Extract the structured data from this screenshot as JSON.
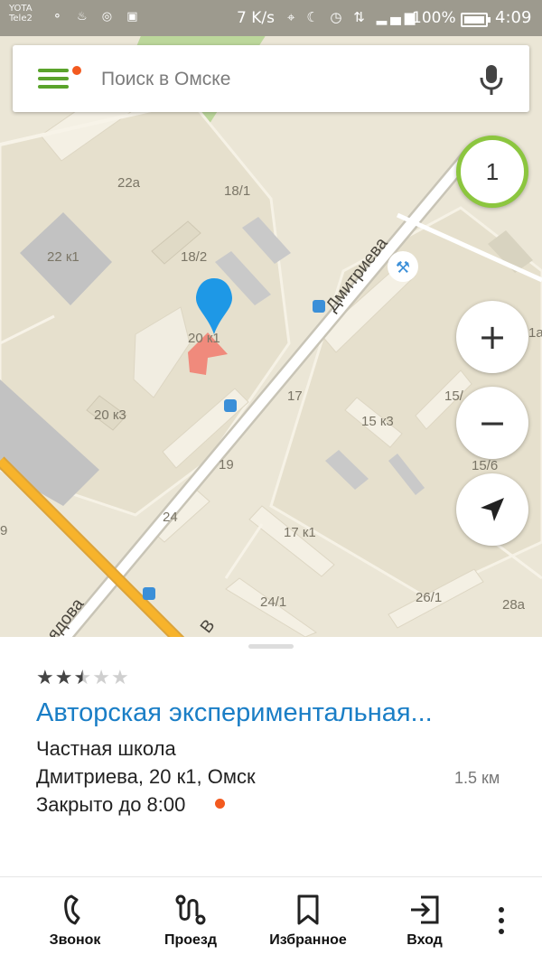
{
  "status_bar": {
    "carrier_line1": "YOTA",
    "carrier_line2": "Tele2",
    "net_speed": "7 K/s",
    "battery": "100%",
    "time": "4:09"
  },
  "search": {
    "placeholder": "Поиск в Омске"
  },
  "map": {
    "counter": "1",
    "streets": {
      "dmitrieva": "Дмитриева",
      "bottom_street": "рядова",
      "corner_letter": "В"
    },
    "labels": {
      "b22a": "22а",
      "b18_1": "18/1",
      "b22k1": "22 к1",
      "b18_2": "18/2",
      "b20k1": "20 к1",
      "b20k3": "20 к3",
      "b17": "17",
      "b15k3": "15 к3",
      "b15_partial": "15/",
      "b15_6": "15/6",
      "b19": "19",
      "b24": "24",
      "b17k1": "17 к1",
      "b24_1": "24/1",
      "b26_1": "26/1",
      "b28a": "28а",
      "b15a_partial": "1а",
      "edge_9": "9"
    }
  },
  "place": {
    "rating": 2.5,
    "stars": [
      "★",
      "★",
      "★",
      "★",
      "★"
    ],
    "title": "Авторская экспериментальная...",
    "category": "Частная школа",
    "address": "Дмитриева, 20 к1, Омск",
    "distance": "1.5 км",
    "hours": "Закрыто до 8:00"
  },
  "actions": {
    "call": "Звонок",
    "route": "Проезд",
    "favorite": "Избранное",
    "entrance": "Вход"
  },
  "colors": {
    "accent_green": "#5aa32b",
    "title_blue": "#1a7ec6",
    "closed_dot": "#f35a1f",
    "main_road": "#f5a623"
  }
}
